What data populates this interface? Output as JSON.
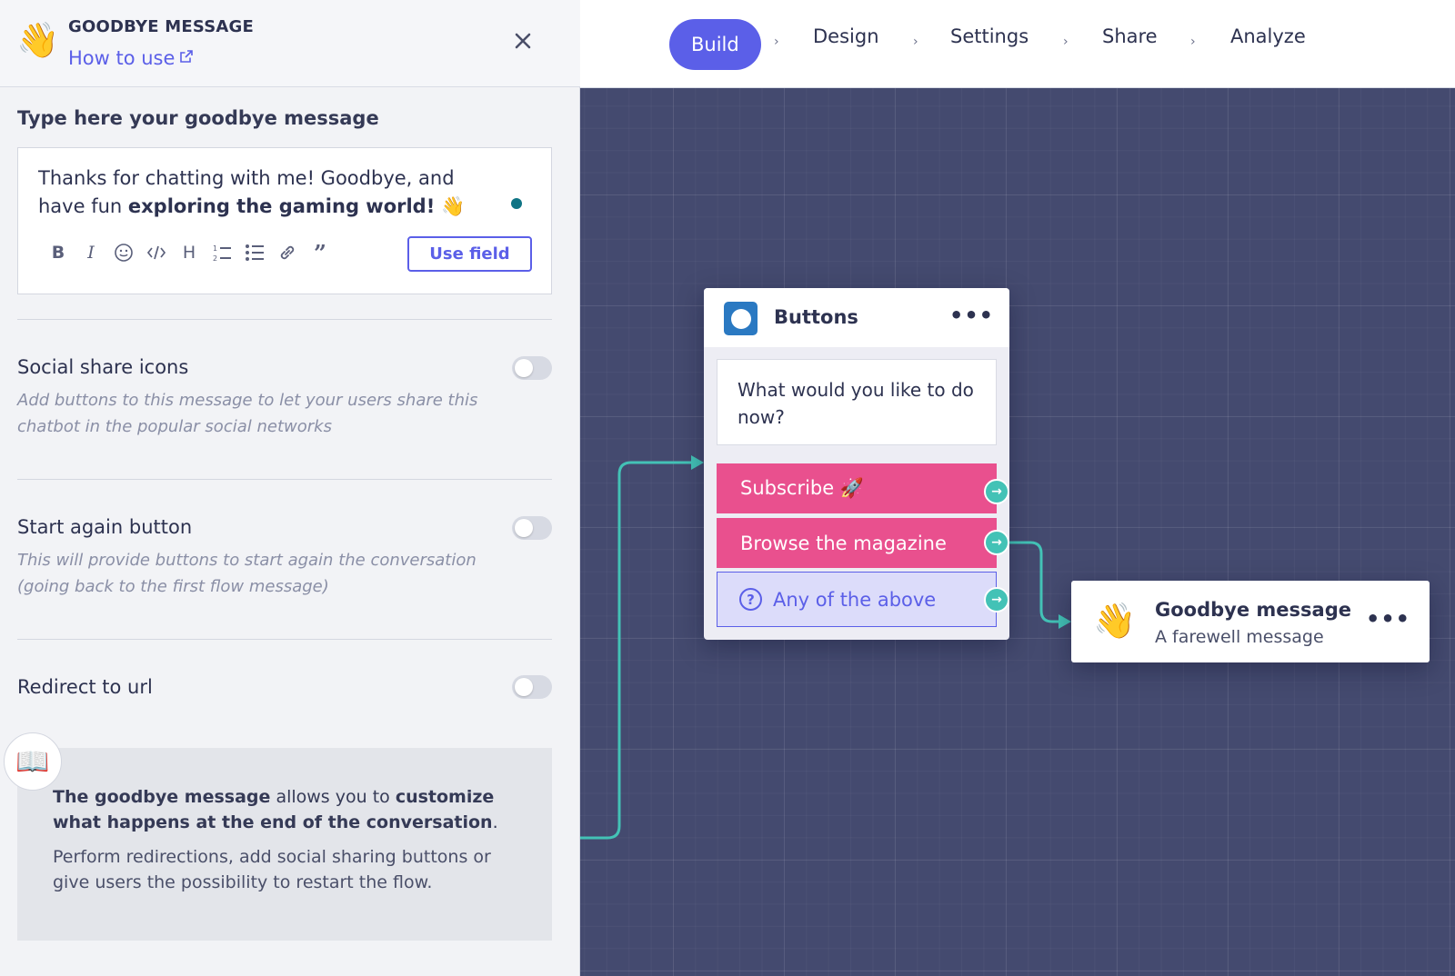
{
  "panel": {
    "emoji": "👋",
    "title": "GOODBYE MESSAGE",
    "how_to_use": "How to use",
    "close_label": "✕",
    "message_label": "Type here your goodbye message",
    "message_text_plain": "Thanks for chatting with me! Goodbye, and have fun ",
    "message_text_bold": "exploring the gaming world!",
    "message_emoji": " 👋",
    "toolbar_icons": [
      "bold-icon",
      "italic-icon",
      "emoji-icon",
      "code-icon",
      "heading-icon",
      "ordered-list-icon",
      "bullet-list-icon",
      "link-icon",
      "quote-icon"
    ],
    "use_field_label": "Use field",
    "options": [
      {
        "title": "Social share icons",
        "description": "Add buttons to this message to let your users share this chatbot in the popular social networks",
        "enabled": false
      },
      {
        "title": "Start again button",
        "description": "This will provide buttons to start again the conversation (going back to the first flow message)",
        "enabled": false
      },
      {
        "title": "Redirect to url",
        "description": "",
        "enabled": false
      }
    ],
    "info": {
      "icon": "📖",
      "p1_a": "The goodbye message",
      "p1_b": " allows you to ",
      "p1_c": "customize what happens at the end of the conversation",
      "p1_d": ".",
      "p2": "Perform redirections, add social sharing buttons or give users the possibility to restart the flow."
    }
  },
  "nav": {
    "steps": [
      "Build",
      "Design",
      "Settings",
      "Share",
      "Analyze"
    ],
    "active": "Build",
    "separator": "›"
  },
  "canvas": {
    "buttons_node": {
      "title": "Buttons",
      "menu": "•••",
      "question": "What would you like to do now?",
      "choices": [
        "Subscribe 🚀",
        "Browse the magazine",
        "Any of the above"
      ],
      "alt_icon": "?",
      "port_icon": "→"
    },
    "goodbye_node": {
      "emoji": "👋",
      "title": "Goodbye message",
      "subtitle": "A farewell message",
      "menu": "•••"
    },
    "colors": {
      "accent": "#5b5fe8",
      "pink": "#e9508e",
      "connector": "#43c2b6",
      "canvas": "#444a6f"
    }
  }
}
